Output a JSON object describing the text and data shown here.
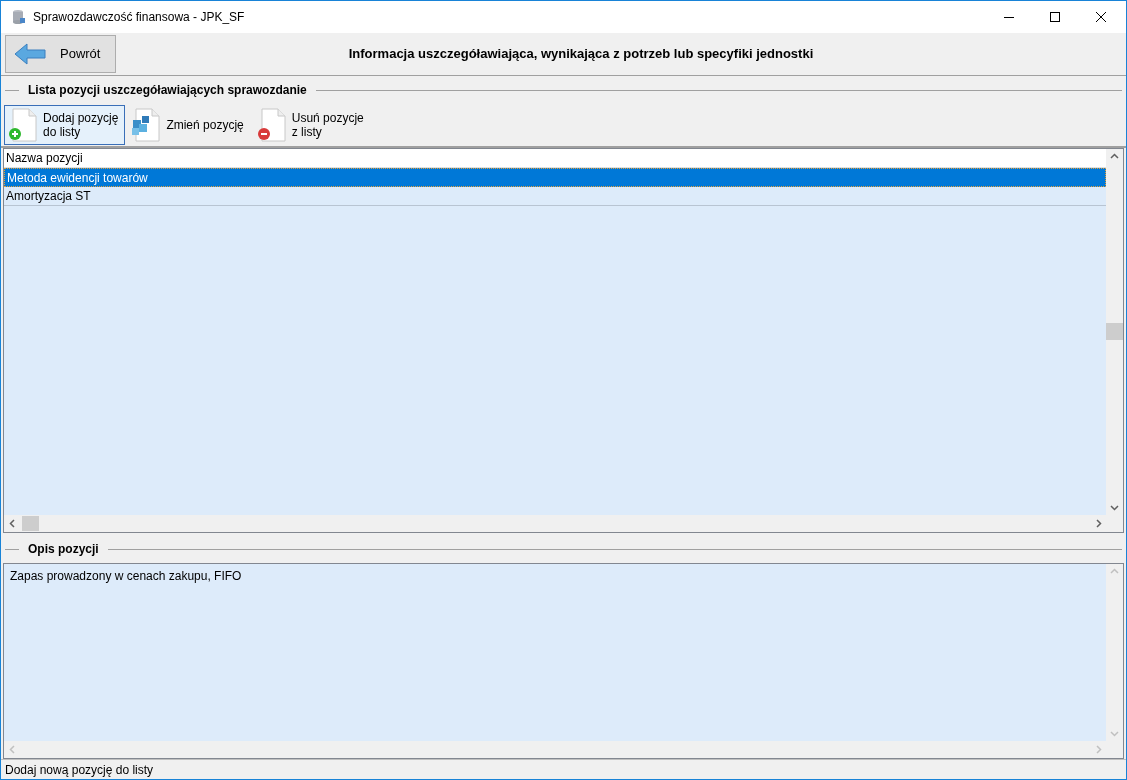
{
  "window": {
    "title": "Sprawozdawczość finansowa - JPK_SF"
  },
  "header": {
    "back_button": "Powrót",
    "title": "Informacja uszczegóławiająca, wynikająca z potrzeb lub specyfiki jednostki"
  },
  "list_section": {
    "title": "Lista pozycji uszczegóławiających sprawozdanie"
  },
  "toolbar": [
    {
      "kind": "add",
      "lines": [
        "Dodaj pozycję",
        "do listy"
      ],
      "focused": true
    },
    {
      "kind": "edit",
      "lines": [
        "Zmień pozycję"
      ],
      "focused": false
    },
    {
      "kind": "remove",
      "lines": [
        "Usuń pozycje",
        "z listy"
      ],
      "focused": false
    }
  ],
  "table": {
    "columns": [
      "Nazwa pozycji"
    ],
    "rows": [
      {
        "name": "Metoda ewidencji towarów",
        "selected": true
      },
      {
        "name": "Amortyzacja ST",
        "selected": false
      }
    ]
  },
  "description_section": {
    "title": "Opis pozycji",
    "value": "Zapas prowadzony w cenach zakupu, FIFO"
  },
  "status_bar": "Dodaj nową pozycję do listy"
}
